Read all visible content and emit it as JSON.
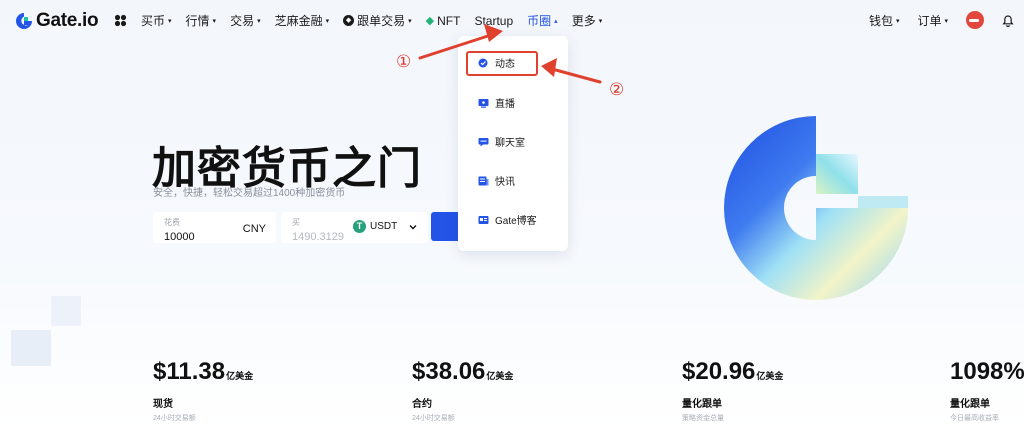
{
  "header": {
    "logo_text": "Gate.io",
    "nav": [
      {
        "label": "买币",
        "caret": "▾"
      },
      {
        "label": "行情",
        "caret": "▾"
      },
      {
        "label": "交易",
        "caret": "▾"
      },
      {
        "label": "芝麻金融",
        "caret": "▾"
      },
      {
        "label": "跟单交易",
        "caret": "▾"
      },
      {
        "label": "NFT"
      },
      {
        "label": "Startup"
      },
      {
        "label": "币圈",
        "caret": "▴"
      },
      {
        "label": "更多",
        "caret": "▾"
      }
    ],
    "right": {
      "wallet": "钱包",
      "orders": "订单",
      "caret": "▾"
    }
  },
  "annotations": {
    "step1": "①",
    "step2": "②",
    "color": "#d93a2b"
  },
  "dropdown": {
    "items": [
      {
        "label": "动态",
        "icon": "feed-icon"
      },
      {
        "label": "直播",
        "icon": "live-icon"
      },
      {
        "label": "聊天室",
        "icon": "chat-icon"
      },
      {
        "label": "快讯",
        "icon": "news-icon"
      },
      {
        "label": "Gate博客",
        "icon": "blog-icon"
      }
    ]
  },
  "hero": {
    "title": "加密货币之门",
    "subtitle": "安全，快捷，轻松交易超过1400种加密货币",
    "spend": {
      "label": "花费",
      "value": "10000",
      "unit": "CNY"
    },
    "buy": {
      "label": "买",
      "value": "1490.3129",
      "unit": "USDT",
      "badge": "T"
    }
  },
  "stats": [
    {
      "value": "$11.38",
      "unit": "亿美金",
      "label": "现货",
      "desc": "24小时交易额"
    },
    {
      "value": "$38.06",
      "unit": "亿美金",
      "label": "合约",
      "desc": "24小时交易额"
    },
    {
      "value": "$20.96",
      "unit": "亿美金",
      "label": "量化跟单",
      "desc": "策略资金总量"
    },
    {
      "value": "1098%",
      "unit": "",
      "label": "量化跟单",
      "desc": "今日最高收益率"
    }
  ],
  "colors": {
    "accent": "#2354e6",
    "annotation": "#e0412f",
    "usdt": "#26a17b"
  }
}
